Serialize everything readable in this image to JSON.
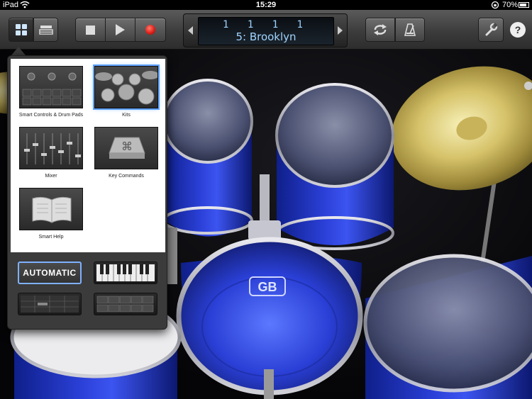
{
  "status_bar": {
    "carrier": "iPad",
    "time": "15:29",
    "battery": "70%",
    "icons": [
      "wifi-icon",
      "rotation-lock-icon",
      "battery-icon"
    ]
  },
  "toolbar": {
    "buttons": [
      "browser-icon",
      "tracks-view-icon",
      "stop-icon",
      "play-icon",
      "record-icon",
      "loop-icon",
      "metronome-icon",
      "settings-wrench-icon",
      "help-icon"
    ],
    "help_label": "?",
    "lcd": {
      "position": "1 1 1 1",
      "song": "5: Brooklyn"
    }
  },
  "popover": {
    "items": [
      {
        "label": "Smart Controls & Drum Pads",
        "selected": false
      },
      {
        "label": "Kits",
        "selected": true
      },
      {
        "label": "Mixer",
        "selected": false
      },
      {
        "label": "Key Commands",
        "selected": false
      },
      {
        "label": "Smart Help",
        "selected": false
      }
    ],
    "play_modes": {
      "automatic": "AUTOMATIC",
      "others": [
        "keyboard-icon",
        "drum-pads-icon",
        "bar-grid-icon"
      ]
    }
  },
  "scene": {
    "bass_drum_logo": "GB"
  },
  "colors": {
    "drum_shell": "#2a3fd6",
    "lcd_text": "#9fd3ff",
    "selection": "#5ea1ff",
    "record": "#e0201a"
  }
}
